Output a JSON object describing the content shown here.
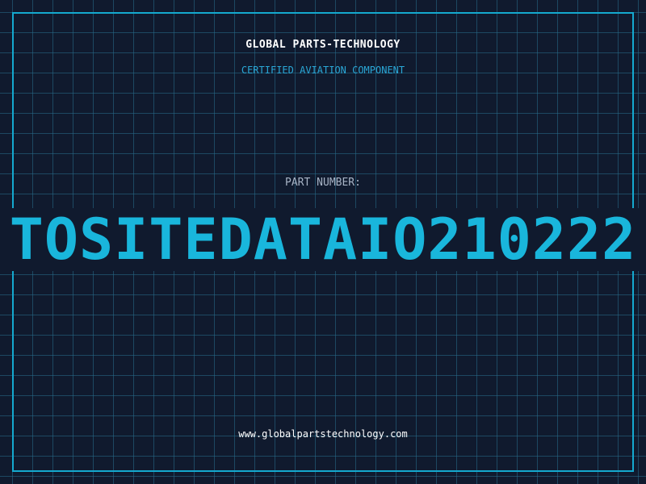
{
  "header": {
    "company": "GLOBAL PARTS-TECHNOLOGY",
    "certification": "CERTIFIED AVIATION COMPONENT"
  },
  "part": {
    "label": "PART NUMBER:",
    "number": "TOSITEDATAIO210222"
  },
  "footer": {
    "website": "www.globalpartstechnology.com"
  },
  "colors": {
    "background": "#101a2e",
    "grid": "#286e8c",
    "accent": "#14a9cf",
    "part_number": "#19b6dc",
    "title": "#ffffff",
    "label": "#a8b4c6"
  }
}
